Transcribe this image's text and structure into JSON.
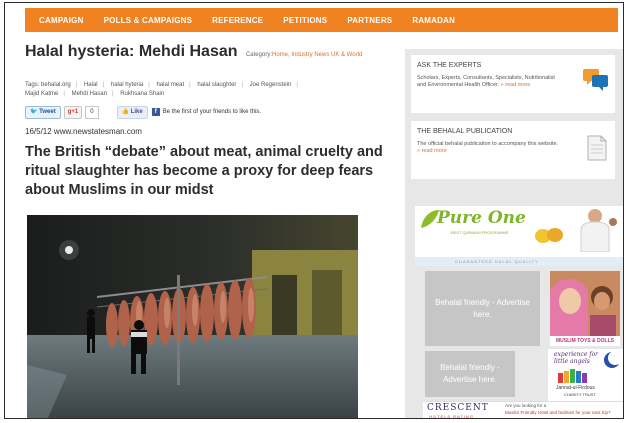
{
  "nav": {
    "items": [
      "CAMPAIGN",
      "POLLS & CAMPAIGNS",
      "REFERENCE",
      "PETITIONS",
      "PARTNERS",
      "RAMADAN"
    ]
  },
  "article": {
    "title": "Halal hysteria: Mehdi Hasan",
    "category_label": "Category:",
    "category_links": "Home, Industry News UK & World",
    "tags_label": "Tags:",
    "tags": [
      "behalal.org",
      "Halal",
      "halal hyteria",
      "halal meat",
      "halal slaughter",
      "Joe Regenstein",
      "Majid Katme",
      "Mehdi Hasan",
      "Rukhsana Shain"
    ],
    "dateline": "16/5/12 www.newstatesman.com",
    "headline": "The British “debate” about meat, animal cruelty and ritual slaughter has become a proxy for deep fears about Muslims in our midst"
  },
  "social": {
    "tweet": "Tweet",
    "gplus": "+1",
    "gplus_count": "0",
    "like": "Like",
    "like_text": "Be the first of your friends to like this."
  },
  "sidebar": {
    "experts": {
      "heading": "ASK THE EXPERTS",
      "text": "Scholars, Experts, Consultants, Specialists, Nutritionalist and Environmental Health Officer.",
      "more": "» read more"
    },
    "publication": {
      "heading": "THE BEHALAL PUBLICATION",
      "text": "The official behalal publication to accompany this website.",
      "more": "» read more"
    },
    "ads": {
      "pure_one": "Pure One",
      "pure_one_sub": "BEST QURBANI PROGRAMME",
      "pure_one_tag": "GUARANTEED HALAL QUALITY",
      "behalal_friendly_1": "Behalal friendly - Advertise here.",
      "behalal_friendly_2": "Behalal friendly - Advertise here.",
      "muslim_toys": "MUSLIM TOYS & DOLLS",
      "experience": "experience for little angels",
      "jannat": "Jannat-ul-Firdous",
      "charity": "CHARITY TRUST",
      "crescent": "CRESCENT",
      "crescent_sub": "HOTELS RATING",
      "crescent_text": "Are you looking for a",
      "crescent_text2": "Muslim Friendly Hotel and facilities for your next trip?"
    }
  },
  "colors": {
    "nav_orange": "#f08222",
    "link_orange": "#e0702a",
    "sidebar_gray": "#e7e7e7",
    "pure_one_green": "#8cbd2c"
  }
}
